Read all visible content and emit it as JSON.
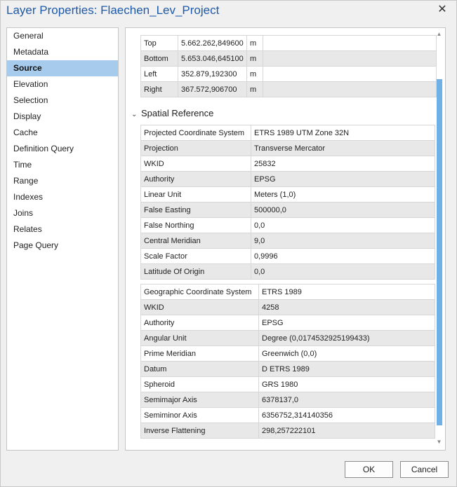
{
  "window": {
    "title": "Layer Properties: Flaechen_Lev_Project",
    "close_icon": "close-icon",
    "close_glyph": "✕"
  },
  "nav": {
    "items": [
      {
        "label": "General",
        "active": false
      },
      {
        "label": "Metadata",
        "active": false
      },
      {
        "label": "Source",
        "active": true
      },
      {
        "label": "Elevation",
        "active": false
      },
      {
        "label": "Selection",
        "active": false
      },
      {
        "label": "Display",
        "active": false
      },
      {
        "label": "Cache",
        "active": false
      },
      {
        "label": "Definition Query",
        "active": false
      },
      {
        "label": "Time",
        "active": false
      },
      {
        "label": "Range",
        "active": false
      },
      {
        "label": "Indexes",
        "active": false
      },
      {
        "label": "Joins",
        "active": false
      },
      {
        "label": "Relates",
        "active": false
      },
      {
        "label": "Page Query",
        "active": false
      }
    ]
  },
  "extent": {
    "rows": [
      {
        "label": "Top",
        "value": "5.662.262,849600",
        "unit": "m"
      },
      {
        "label": "Bottom",
        "value": "5.653.046,645100",
        "unit": "m"
      },
      {
        "label": "Left",
        "value": "352.879,192300",
        "unit": "m"
      },
      {
        "label": "Right",
        "value": "367.572,906700",
        "unit": "m"
      }
    ]
  },
  "spatial_reference": {
    "heading": "Spatial Reference",
    "chevron": "⌄",
    "projected": [
      {
        "label": "Projected Coordinate System",
        "value": "ETRS 1989 UTM Zone 32N"
      },
      {
        "label": "Projection",
        "value": "Transverse Mercator"
      },
      {
        "label": "WKID",
        "value": "25832"
      },
      {
        "label": "Authority",
        "value": "EPSG"
      },
      {
        "label": "Linear Unit",
        "value": "Meters (1,0)"
      },
      {
        "label": "False Easting",
        "value": "500000,0"
      },
      {
        "label": "False Northing",
        "value": "0,0"
      },
      {
        "label": "Central Meridian",
        "value": "9,0"
      },
      {
        "label": "Scale Factor",
        "value": "0,9996"
      },
      {
        "label": "Latitude Of Origin",
        "value": "0,0"
      }
    ],
    "geographic": [
      {
        "label": "Geographic Coordinate System",
        "value": "ETRS 1989"
      },
      {
        "label": "WKID",
        "value": "4258"
      },
      {
        "label": "Authority",
        "value": "EPSG"
      },
      {
        "label": "Angular Unit",
        "value": "Degree (0,0174532925199433)"
      },
      {
        "label": "Prime Meridian",
        "value": "Greenwich (0,0)"
      },
      {
        "label": "Datum",
        "value": "D ETRS 1989"
      },
      {
        "label": "Spheroid",
        "value": "GRS 1980"
      },
      {
        "label": "Semimajor Axis",
        "value": "6378137,0"
      },
      {
        "label": "Semiminor Axis",
        "value": "6356752,314140356"
      },
      {
        "label": "Inverse Flattening",
        "value": "298,257222101"
      }
    ]
  },
  "scrollbar": {
    "up_glyph": "▲",
    "down_glyph": "▼"
  },
  "buttons": {
    "ok_label": "OK",
    "cancel_label": "Cancel"
  }
}
